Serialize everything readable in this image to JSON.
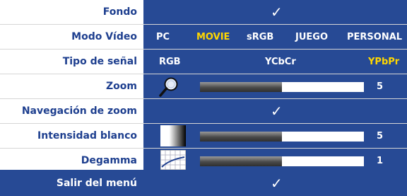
{
  "menu": {
    "rows": [
      {
        "label": "Fondo"
      },
      {
        "label": "Modo Vídeo",
        "options": [
          "PC",
          "MOVIE",
          "sRGB",
          "JUEGO",
          "PERSONAL"
        ],
        "selected": "MOVIE"
      },
      {
        "label": "Tipo de señal",
        "options": [
          "RGB",
          "YCbCr",
          "YPbPr"
        ],
        "selected": "YPbPr"
      },
      {
        "label": "Zoom",
        "value": "5",
        "level": 0.5
      },
      {
        "label": "Navegación de zoom"
      },
      {
        "label": "Intensidad blanco",
        "value": "5",
        "level": 0.5
      },
      {
        "label": "Degamma",
        "value": "1",
        "level": 0.5
      }
    ],
    "exit_label": "Salir del menú",
    "check_glyph": "✓"
  },
  "colors": {
    "panel": "#274a95",
    "label_text": "#1e3f8f",
    "selected_option": "#ffd700"
  }
}
